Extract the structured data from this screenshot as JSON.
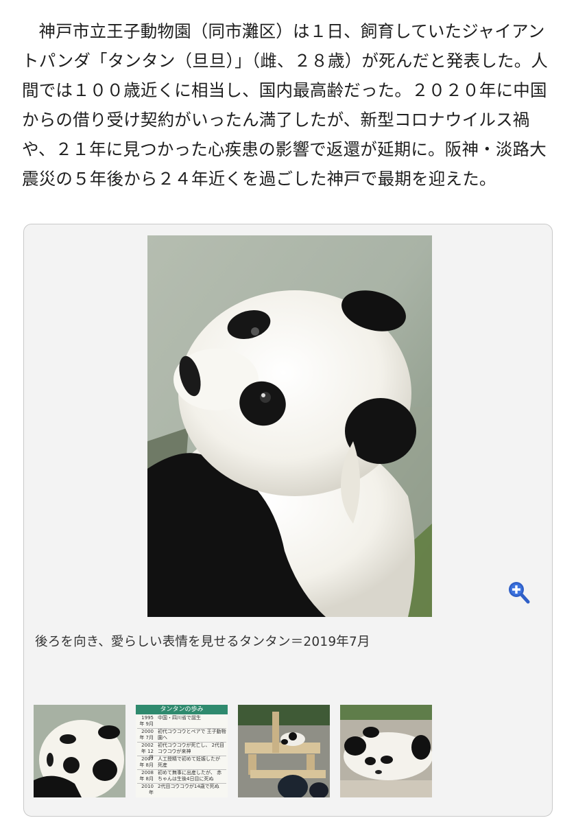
{
  "article": {
    "body": "神戸市立王子動物園（同市灘区）は１日、飼育していたジャイアントパンダ「タンタン（旦旦）」（雌、２８歳）が死んだと発表した。人間では１００歳近くに相当し、国内最高齢だった。２０２０年に中国からの借り受け契約がいったん満了したが、新型コロナウイルス禍や、２１年に見つかった心疾患の影響で返還が延期に。阪神・淡路大震災の５年後から２４年近くを過ごした神戸で最期を迎えた。"
  },
  "gallery": {
    "caption": "後ろを向き、愛らしい表情を見せるタンタン＝2019年7月",
    "zoom_icon": "magnify-plus-icon",
    "timeline_thumb": {
      "title": "タンタンの歩み",
      "rows": [
        {
          "date": "1995年 9月",
          "text": "中国・四川省で誕生"
        },
        {
          "date": "2000年 7月",
          "text": "初代コウコウとペアで 王子動物園へ"
        },
        {
          "date": "2002年 12月",
          "text": "初代コウコウが死亡し、 2代目コウコウが来神"
        },
        {
          "date": "2007年 8月",
          "text": "人工授精で初めて妊娠したが 死産"
        },
        {
          "date": "2008年 8月",
          "text": "初めて無事に出産したが、 赤ちゃんは生後4日目に死ぬ"
        },
        {
          "date": "2010年",
          "text": "2代目コウコウが14歳で死ぬ"
        }
      ]
    }
  }
}
